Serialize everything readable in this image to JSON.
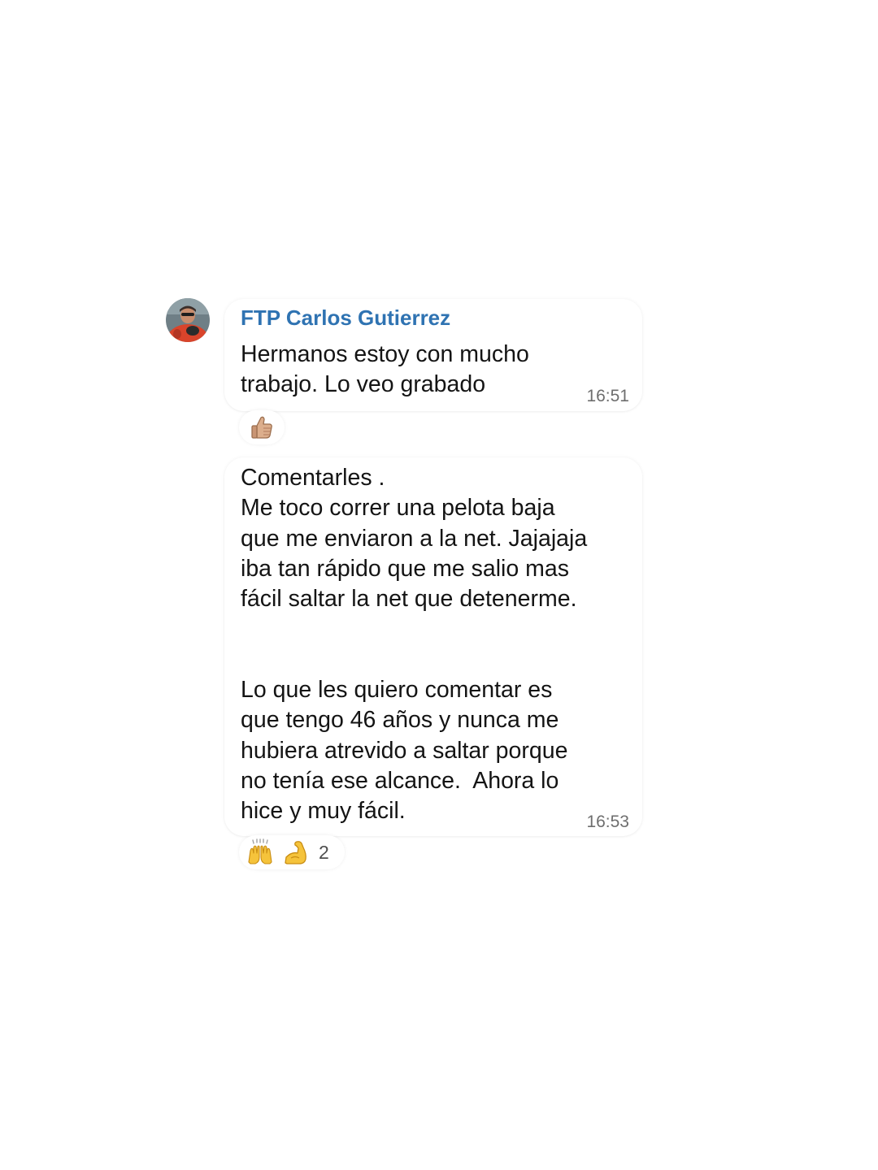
{
  "chat": {
    "sender_name": "FTP Carlos Gutierrez",
    "messages": [
      {
        "text": "Hermanos estoy con mucho\ntrabajo. Lo veo grabado",
        "time": "16:51",
        "reactions": {
          "icons": [
            "thumbs-up-icon"
          ],
          "count": ""
        }
      },
      {
        "text": "Comentarles .\nMe toco correr una pelota baja\nque me enviaron a la net. Jajajaja\niba tan rápido que me salio mas\nfácil saltar la net que detenerme.\n\n\nLo que les quiero comentar es\nque tengo 46 años y nunca me\nhubiera atrevido a saltar porque\nno tenía ese alcance.  Ahora lo\nhice y muy fácil.",
        "time": "16:53",
        "reactions": {
          "icons": [
            "raising-hands-icon",
            "flexed-biceps-icon"
          ],
          "count": "2"
        }
      }
    ]
  },
  "colors": {
    "sender_name": "#2f73b2",
    "message_text": "#141414",
    "timestamp": "#6e6e6e",
    "background": "#ffffff"
  }
}
